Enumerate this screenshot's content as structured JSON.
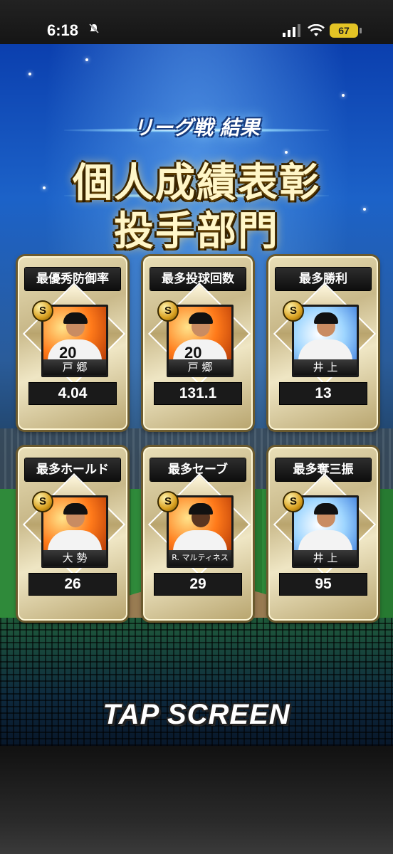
{
  "status_bar": {
    "time": "6:18",
    "battery": "67"
  },
  "screen": {
    "subtitle": "リーグ戦 結果",
    "title_line1": "個人成績表彰",
    "title_line2": "投手部門",
    "tap_prompt": "TAP SCREEN"
  },
  "awards": [
    {
      "title": "最優秀防御率",
      "player": "戸 郷",
      "rank_badge": "S",
      "value": "4.04",
      "portrait_style": "orange"
    },
    {
      "title": "最多投球回数",
      "player": "戸 郷",
      "rank_badge": "S",
      "value": "131.1",
      "portrait_style": "orange"
    },
    {
      "title": "最多勝利",
      "player": "井 上",
      "rank_badge": "S",
      "value": "13",
      "portrait_style": "blue"
    },
    {
      "title": "最多ホールド",
      "player": "大 勢",
      "rank_badge": "S",
      "value": "26",
      "portrait_style": "orange"
    },
    {
      "title": "最多セーブ",
      "player": "R. マルティネス",
      "rank_badge": "S",
      "value": "29",
      "portrait_style": "orange"
    },
    {
      "title": "最多奪三振",
      "player": "井 上",
      "rank_badge": "S",
      "value": "95",
      "portrait_style": "blue"
    }
  ]
}
